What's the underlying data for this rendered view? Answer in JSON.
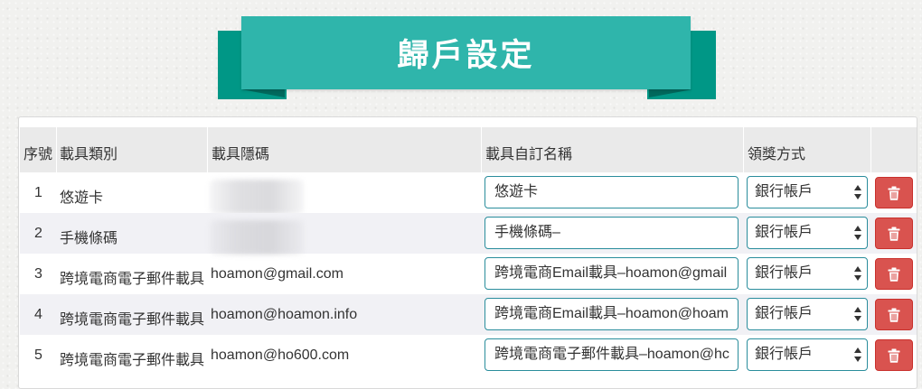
{
  "page": {
    "title": "歸戶設定"
  },
  "table": {
    "headers": {
      "index": "序號",
      "type": "載具類別",
      "code": "載具隱碼",
      "name": "載具自訂名稱",
      "award": "領獎方式"
    },
    "rows": [
      {
        "index": "1",
        "type": "悠遊卡",
        "code": "",
        "code_hidden": true,
        "name": "悠遊卡",
        "award": "銀行帳戶"
      },
      {
        "index": "2",
        "type": "手機條碼",
        "code": "",
        "code_hidden": true,
        "name": "手機條碼–",
        "award": "銀行帳戶"
      },
      {
        "index": "3",
        "type": "跨境電商電子郵件載具",
        "code": "hoamon@gmail.com",
        "code_hidden": false,
        "name": "跨境電商Email載具–hoamon@gmail",
        "award": "銀行帳戶"
      },
      {
        "index": "4",
        "type": "跨境電商電子郵件載具",
        "code": "hoamon@hoamon.info",
        "code_hidden": false,
        "name": "跨境電商Email載具–hoamon@hoam",
        "award": "銀行帳戶"
      },
      {
        "index": "5",
        "type": "跨境電商電子郵件載具",
        "code": "hoamon@ho600.com",
        "code_hidden": false,
        "name": "跨境電商電子郵件載具–hoamon@hc",
        "award": "銀行帳戶"
      }
    ]
  },
  "icons": {
    "delete": "trash-icon",
    "select": "select-arrows-icon"
  },
  "colors": {
    "banner": "#2fb5ab",
    "banner_dark": "#009786",
    "input_border": "#2a8d9c",
    "danger": "#d9534f",
    "row_alt": "#f1f1f5",
    "header_bg": "#eaeaea"
  }
}
